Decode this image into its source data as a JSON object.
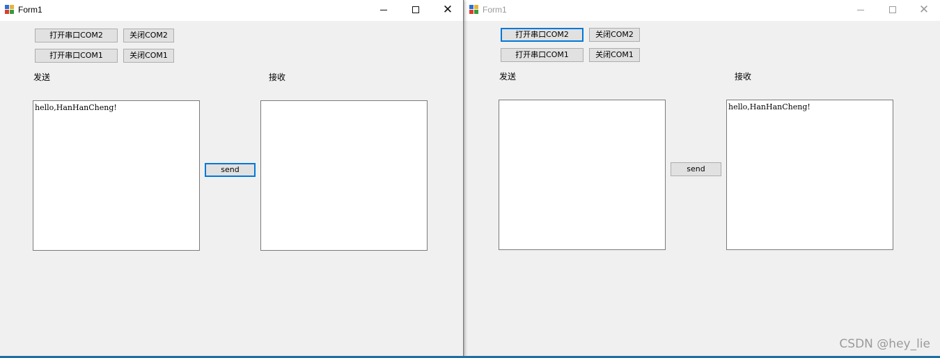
{
  "windows": [
    {
      "title": "Form1",
      "close_glyph": "✕",
      "buttons": {
        "open_com2": "打开串口COM2",
        "close_com2": "关闭COM2",
        "open_com1": "打开串口COM1",
        "close_com1": "关闭COM1",
        "send": "send"
      },
      "labels": {
        "send": "发送",
        "receive": "接收"
      },
      "send_text": "hello,HanHanCheng!",
      "receive_text": ""
    },
    {
      "title": "Form1",
      "close_glyph": "✕",
      "buttons": {
        "open_com2": "打开串口COM2",
        "close_com2": "关闭COM2",
        "open_com1": "打开串口COM1",
        "close_com1": "关闭COM1",
        "send": "send"
      },
      "labels": {
        "send": "发送",
        "receive": "接收"
      },
      "send_text": "",
      "receive_text": "hello,HanHanCheng!"
    }
  ],
  "watermark": "CSDN @hey_lie",
  "colors": {
    "focus": "#0078d7",
    "window_bg": "#f0f0f0",
    "taskbar": "#1c6ea4"
  }
}
